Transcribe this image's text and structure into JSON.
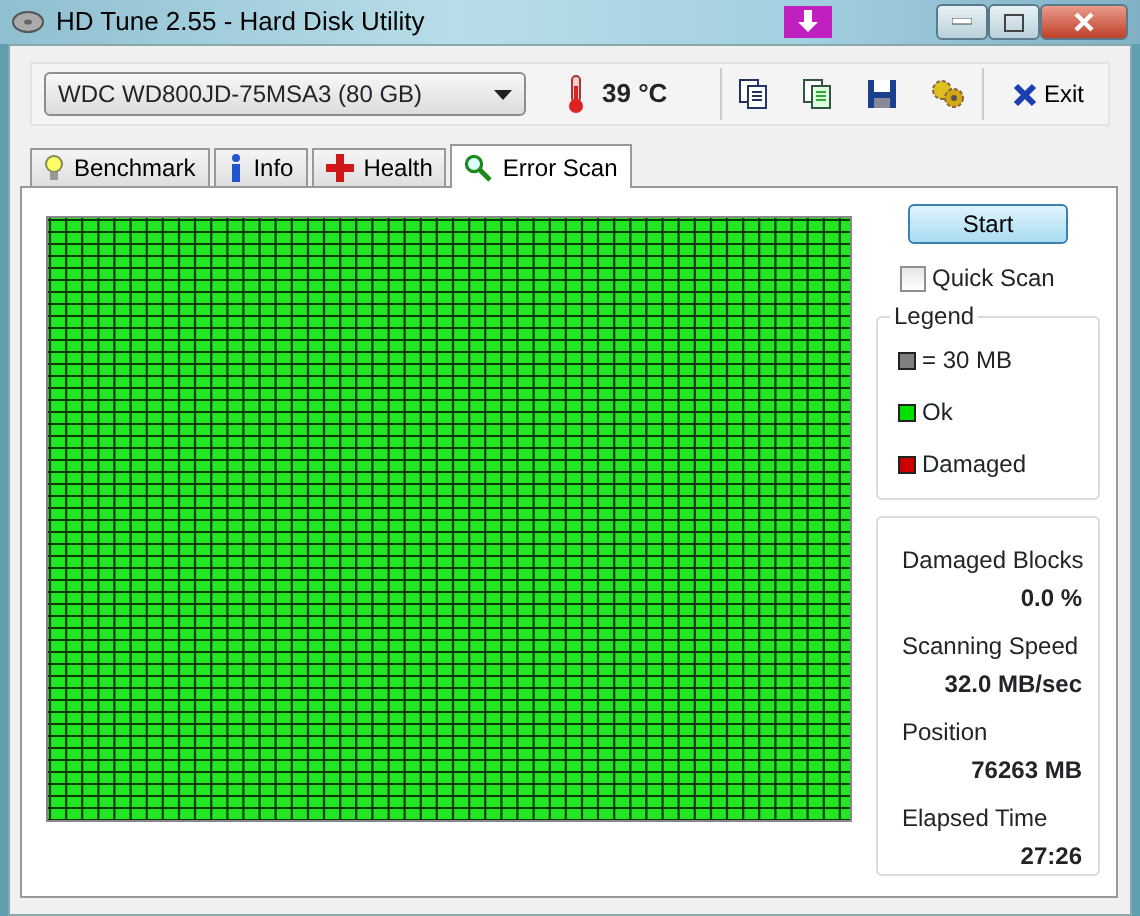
{
  "window": {
    "title": "HD Tune 2.55 - Hard Disk Utility"
  },
  "toolbar": {
    "drive": "WDC WD800JD-75MSA3 (80 GB)",
    "temperature": "39 °C",
    "exit": "Exit"
  },
  "tabs": [
    {
      "label": "Benchmark",
      "selected": false
    },
    {
      "label": "Info",
      "selected": false
    },
    {
      "label": "Health",
      "selected": false
    },
    {
      "label": "Error Scan",
      "selected": true
    }
  ],
  "start_button": "Start",
  "quick_scan": {
    "label": "Quick Scan",
    "checked": false
  },
  "legend": {
    "title": "Legend",
    "items": [
      {
        "label": "= 30 MB",
        "color": "#808080"
      },
      {
        "label": "Ok",
        "color": "#00e000"
      },
      {
        "label": "Damaged",
        "color": "#cc0000"
      }
    ]
  },
  "stats": [
    {
      "label": "Damaged Blocks",
      "value": "0.0 %"
    },
    {
      "label": "Scanning Speed",
      "value": "32.0 MB/sec"
    },
    {
      "label": "Position",
      "value": "76263 MB"
    },
    {
      "label": "Elapsed Time",
      "value": "27:26"
    }
  ]
}
